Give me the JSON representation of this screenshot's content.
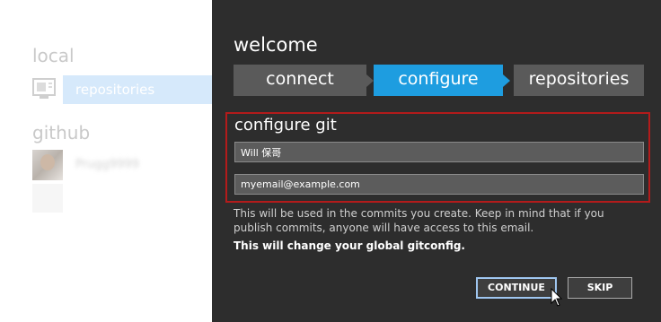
{
  "sidebar": {
    "local_heading": "local",
    "repositories_label": "repositories",
    "github_heading": "github",
    "github_user": "Prugg9999"
  },
  "dialog": {
    "title": "welcome",
    "steps": [
      {
        "label": "connect",
        "state": "done"
      },
      {
        "label": "configure",
        "state": "active"
      },
      {
        "label": "repositories",
        "state": "pending"
      }
    ],
    "section_title": "configure git",
    "name_value": "Will 保哥",
    "email_value": "myemail@example.com",
    "description": "This will be used in the commits you create. Keep in mind that if you publish commits, anyone will have access to this email.",
    "warning": "This will change your global gitconfig.",
    "continue_label": "CONTINUE",
    "skip_label": "SKIP"
  },
  "colors": {
    "panel_bg": "#2d2d2d",
    "step_active": "#1e9de0",
    "step_inactive": "#5a5a5a",
    "highlight_border": "#b31b1b"
  }
}
